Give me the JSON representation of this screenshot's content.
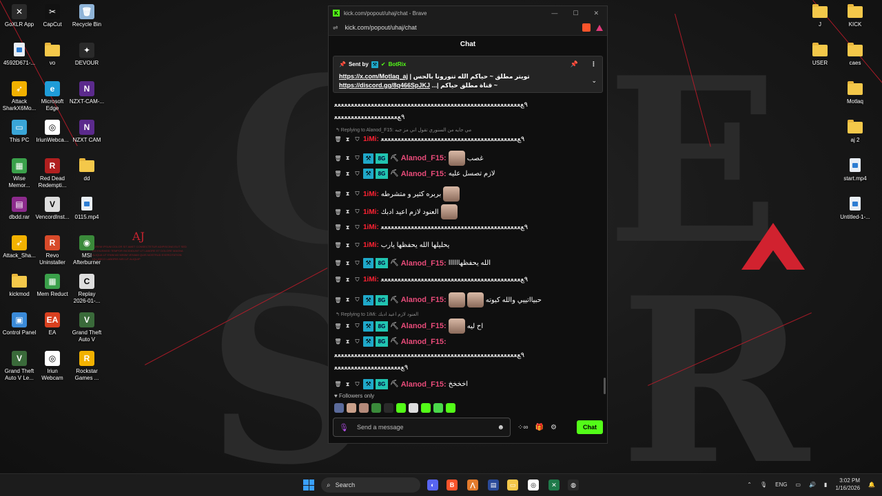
{
  "desktop_left": [
    {
      "label": "GoXLR App",
      "color": "#2a2a2a",
      "glyph": "✕"
    },
    {
      "label": "CapCut",
      "color": "#111111",
      "glyph": "✂"
    },
    {
      "label": "Recycle Bin",
      "color": "#8fb4d8",
      "glyph": "🗑"
    },
    {
      "label": "4592D671-...",
      "kind": "file"
    },
    {
      "label": "vo",
      "kind": "folder"
    },
    {
      "label": "DEVOUR",
      "color": "#2a2a2a",
      "glyph": "✦"
    },
    {
      "label": "Attack\nSharkX6Mo...",
      "color": "#f2b100",
      "glyph": "➶"
    },
    {
      "label": "Microsoft\nEdge",
      "color": "#1f9cd8",
      "glyph": "e"
    },
    {
      "label": "NZXT-CAM-...",
      "color": "#5b2a8c",
      "glyph": "N"
    },
    {
      "label": "This PC",
      "color": "#3aa6d8",
      "glyph": "▭"
    },
    {
      "label": "IriunWebca...",
      "color": "#ffffff",
      "glyph": "◎"
    },
    {
      "label": "NZXT CAM",
      "color": "#5b2a8c",
      "glyph": "N"
    },
    {
      "label": "Wise\nMemor...",
      "color": "#3aa04a",
      "glyph": "▦"
    },
    {
      "label": "Red Dead\nRedempti...",
      "color": "#b01f1f",
      "glyph": "R"
    },
    {
      "label": "dd",
      "kind": "folder"
    },
    {
      "label": "dbdd.rar",
      "color": "#8c2a8c",
      "glyph": "▤"
    },
    {
      "label": "VencordInst...",
      "color": "#dddddd",
      "glyph": "V"
    },
    {
      "label": "0115.mp4",
      "kind": "file"
    },
    {
      "label": "Attack_Sha...",
      "color": "#f2b100",
      "glyph": "➶"
    },
    {
      "label": "Revo\nUninstaller",
      "color": "#d84a2a",
      "glyph": "R"
    },
    {
      "label": "MSI\nAfterburner",
      "color": "#3a8a3a",
      "glyph": "◉"
    },
    {
      "label": "kickmod",
      "kind": "folder"
    },
    {
      "label": "Mem Reduct",
      "color": "#3aa04a",
      "glyph": "▦"
    },
    {
      "label": "Replay\n2026-01-...",
      "color": "#dddddd",
      "glyph": "C"
    },
    {
      "label": "Control Panel",
      "color": "#3a8ad8",
      "glyph": "▣"
    },
    {
      "label": "EA",
      "color": "#d8401f",
      "glyph": "EA"
    },
    {
      "label": "Grand Theft\nAuto V",
      "color": "#3a6a3a",
      "glyph": "V"
    },
    {
      "label": "Grand Theft\nAuto V Le...",
      "color": "#3a6a3a",
      "glyph": "V"
    },
    {
      "label": "Iriun\nWebcam",
      "color": "#ffffff",
      "glyph": "◎"
    },
    {
      "label": "Rockstar\nGames ...",
      "color": "#f2b100",
      "glyph": "R"
    }
  ],
  "desktop_right": [
    {
      "label": "J",
      "kind": "folder"
    },
    {
      "label": "KICK",
      "kind": "folder"
    },
    {
      "label": "USER",
      "kind": "folder"
    },
    {
      "label": "caes",
      "kind": "folder"
    },
    {
      "label": "Motlaq",
      "kind": "folder"
    },
    {
      "label": "aj 2",
      "kind": "folder"
    },
    {
      "label": "start.mp4",
      "kind": "file"
    },
    {
      "label": "Untitled-1-...",
      "kind": "file"
    }
  ],
  "browser": {
    "title": "kick.com/popout/uhaj/chat - Brave",
    "url": "kick.com/popout/uhaj/chat",
    "chat_title": "Chat"
  },
  "pinned": {
    "sent_by": "Sent by",
    "bot": "BotRix",
    "line1_link": "https://x.com/Motlaq_aj",
    "line1_text": "| تويتر مطلق ~ حياكم الله تنورونا بالحس",
    "line2_link": "https://discord.gg/8q466SpJKJ",
    "line2_text": "...| قناة مطلق حياكم ~"
  },
  "messages": {
    "top_spam1": "٩ﻊﻌﻌﻌﻌﻌﻌﻌﻌﻌﻌﻌﻌﻌﻌﻌﻌﻌﻌﻌﻌﻌﻌﻌﻌﻌﻌﻌﻌﻌﻌﻌﻌﻌﻌﻌﻌﻌﻌﻌﻌﻌﻌﻌﻌﻌﻌﻌﻌﻌﻌﻌﻌﻌﻌﻌﻌ",
    "top_spam2": "٩ﻊﻌﻌﻌﻌﻌﻌﻌﻌﻌﻌﻌﻌﻌﻌﻌﻌﻌﻌﻌ",
    "reply1": "↰ Replying to Alanod_F15: مي جايه من السنوري تقول اني مز جبه",
    "m1_user": "1iMi:",
    "m1_text": "٩ﻊﻌﻌﻌﻌﻌﻌﻌﻌﻌﻌﻌﻌﻌﻌﻌﻌﻌﻌﻌﻌﻌﻌﻌﻌﻌﻌﻌﻌﻌﻌﻌﻌﻌﻌﻌﻌﻌﻌﻌﻌﻌ",
    "m2_user": "Alanod_F15:",
    "m2_text": "غصب",
    "m3_user": "Alanod_F15:",
    "m3_text": "لازم تصسل عليه",
    "m4_user": "1iMi:",
    "m4_text": "بربره كثير و متشرطه",
    "m5_user": "1iMi:",
    "m5_text": "العنود لازم اعيد ادبك",
    "m6_user": "1iMi:",
    "m6_text": "٩ﻊﻌﻌﻌﻌﻌﻌﻌﻌﻌﻌﻌﻌﻌﻌﻌﻌﻌﻌﻌﻌﻌﻌﻌﻌﻌﻌﻌﻌﻌﻌﻌﻌﻌﻌﻌﻌﻌﻌﻌﻌﻌﻌ",
    "m7_user": "1iMi:",
    "m7_text": "يحليلها الله يحفظها يارب",
    "m8_user": "Alanod_F15:",
    "m8_text": "الله يحفظهاااااا",
    "m9_user": "1iMi:",
    "m9_text": "٩ﻊﻌﻌﻌﻌﻌﻌﻌﻌﻌﻌﻌﻌﻌﻌﻌﻌﻌﻌﻌﻌﻌﻌﻌﻌﻌﻌﻌﻌﻌﻌﻌﻌﻌﻌﻌﻌﻌﻌﻌﻌﻌﻌ",
    "m10_user": "Alanod_F15:",
    "m10_text": "حبيااتييي والله كيوته",
    "reply2": "↰ Replying to 1iMi: العنود لازم اعيد ادبك",
    "m11_user": "Alanod_F15:",
    "m11_text": "اح ليه",
    "m12_user": "Alanod_F15:",
    "m12_spam1": "٩ﻊﻌﻌﻌﻌﻌﻌﻌﻌﻌﻌﻌﻌﻌﻌﻌﻌﻌﻌﻌﻌﻌﻌﻌﻌﻌﻌﻌﻌﻌﻌﻌﻌﻌﻌﻌﻌﻌﻌﻌﻌﻌﻌﻌﻌﻌﻌﻌﻌﻌﻌﻌﻌﻌﻌﻌ",
    "m12_spam2": "٩ﻊﻌﻌﻌﻌﻌﻌﻌﻌﻌﻌﻌﻌﻌﻌﻌﻌﻌﻌﻌﻌ",
    "m13_user": "Alanod_F15:",
    "m13_text": "اخخخخ"
  },
  "followers_only": "Followers only",
  "input": {
    "placeholder": "Send a message",
    "chat_button": "Chat"
  },
  "wallpaper": {
    "aj_logo": "AJ",
    "aj_text": "LOREM IPSUM DOLOR SIT AMET CONSECTETUR ADIPISCING ELIT SED DO EIUSMOD TEMPOR INCIDIDUNT UT LABORE ET DOLORE MAGNA ALIQUA UT ENIM AD MINIM VENIAM QUIS NOSTRUD EXERCITATION ULLAMCO LABORIS NISI UT ALIQUIP"
  },
  "taskbar": {
    "search": "Search",
    "lang": "ENG",
    "time": "3:02 PM",
    "date": "1/16/2026"
  },
  "colors": {
    "kick_green": "#53fc18",
    "alanod_pink": "#e94b7a",
    "imi_red": "#ff2233",
    "bot_green": "#53fc18"
  }
}
